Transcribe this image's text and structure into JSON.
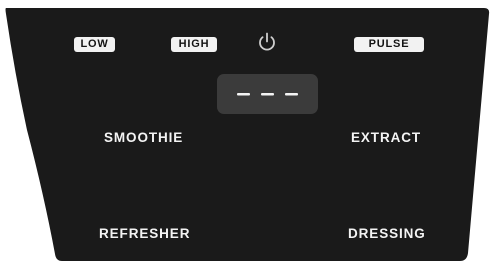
{
  "colors": {
    "panel": "#1a1a1a",
    "pill_background": "#f2f2f2",
    "pill_text": "#141414",
    "label_text": "#f4f4f4",
    "display_background": "#3b3b3b",
    "display_segments": "#f4f4f4",
    "background": "#ffffff"
  },
  "speed_buttons": {
    "low": "LOW",
    "high": "HIGH",
    "pulse": "PULSE"
  },
  "power": {
    "icon": "power-icon"
  },
  "display": {
    "text": "- - -"
  },
  "programs": {
    "smoothie": "SMOOTHIE",
    "extract": "EXTRACT",
    "refresher": "REFRESHER",
    "dressing": "DRESSING"
  }
}
